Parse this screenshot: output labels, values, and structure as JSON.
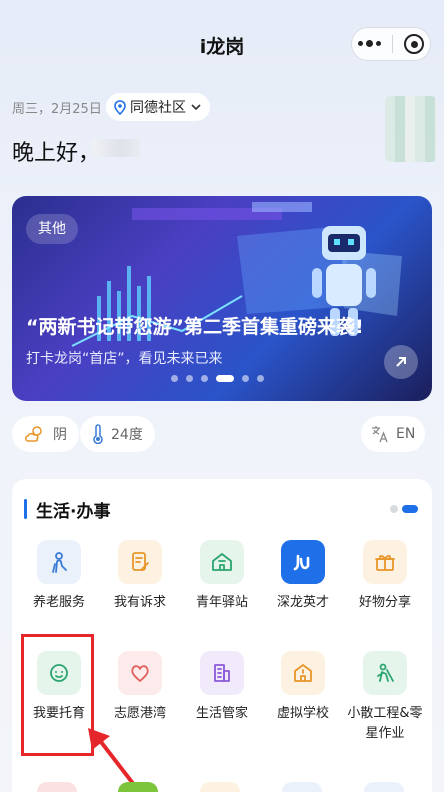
{
  "app": {
    "title": "i龙岗"
  },
  "header": {
    "date": "周三，2月25日",
    "community": "同德社区",
    "greeting": "晚上好，"
  },
  "banner": {
    "tag": "其他",
    "title": "“两新书记带您游”第二季首集重磅来袭!",
    "subtitle": "打卡龙岗“首店”，看见未来已来",
    "active_index": 3,
    "slide_count": 6
  },
  "weather": {
    "condition": "阴",
    "temperature": "24度",
    "language_label": "EN"
  },
  "services": {
    "section_title": "生活·办事",
    "items": [
      {
        "label": "养老服务",
        "icon": "elderly-icon",
        "color": "#3a7bd5",
        "bg": "#eaf1fb"
      },
      {
        "label": "我有诉求",
        "icon": "note-edit-icon",
        "color": "#e8962a",
        "bg": "#fdf1e2"
      },
      {
        "label": "青年驿站",
        "icon": "house-icon",
        "color": "#2ba56f",
        "bg": "#e5f5ec"
      },
      {
        "label": "深龙英才",
        "icon": "shenlong-logo-icon",
        "color": "#1f6fe8",
        "bg": "#1f6fe8"
      },
      {
        "label": "好物分享",
        "icon": "gift-icon",
        "color": "#e8962a",
        "bg": "#fdf1e2"
      },
      {
        "label": "我要托育",
        "icon": "baby-face-icon",
        "color": "#2ba56f",
        "bg": "#e5f5ec"
      },
      {
        "label": "志愿港湾",
        "icon": "heart-icon",
        "color": "#e0615f",
        "bg": "#fcebea"
      },
      {
        "label": "生活管家",
        "icon": "building-icon",
        "color": "#8a5bd6",
        "bg": "#f1eafb"
      },
      {
        "label": "虚拟学校",
        "icon": "school-icon",
        "color": "#e8962a",
        "bg": "#fdf1e2"
      },
      {
        "label": "小散工程&零星作业",
        "icon": "worker-icon",
        "color": "#2ba56f",
        "bg": "#e5f5ec"
      }
    ]
  }
}
